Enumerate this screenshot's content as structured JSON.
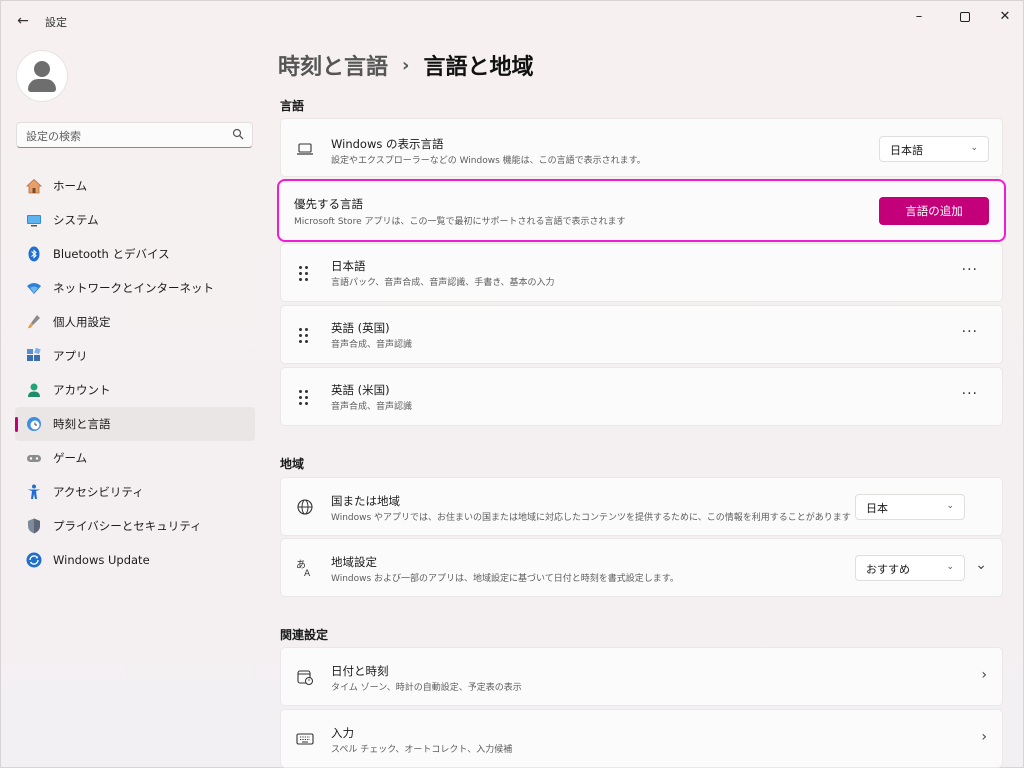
{
  "window": {
    "title": "設定"
  },
  "search": {
    "placeholder": "設定の検索"
  },
  "sidebar": {
    "items": [
      {
        "label": "ホーム",
        "icon": "home-icon"
      },
      {
        "label": "システム",
        "icon": "system-icon"
      },
      {
        "label": "Bluetooth とデバイス",
        "icon": "bluetooth-icon"
      },
      {
        "label": "ネットワークとインターネット",
        "icon": "network-icon"
      },
      {
        "label": "個人用設定",
        "icon": "personalization-icon"
      },
      {
        "label": "アプリ",
        "icon": "apps-icon"
      },
      {
        "label": "アカウント",
        "icon": "account-icon"
      },
      {
        "label": "時刻と言語",
        "icon": "time-language-icon",
        "active": true
      },
      {
        "label": "ゲーム",
        "icon": "game-icon"
      },
      {
        "label": "アクセシビリティ",
        "icon": "accessibility-icon"
      },
      {
        "label": "プライバシーとセキュリティ",
        "icon": "shield-icon"
      },
      {
        "label": "Windows Update",
        "icon": "update-icon"
      }
    ]
  },
  "breadcrumb": {
    "parent": "時刻と言語",
    "separator": "›",
    "current": "言語と地域"
  },
  "sections": {
    "language": "言語",
    "region": "地域",
    "related": "関連設定"
  },
  "display_language": {
    "title": "Windows の表示言語",
    "desc": "設定やエクスプローラーなどの Windows 機能は、この言語で表示されます。",
    "value": "日本語"
  },
  "preferred": {
    "title": "優先する言語",
    "desc": "Microsoft Store アプリは、この一覧で最初にサポートされる言語で表示されます",
    "button": "言語の追加"
  },
  "languages": [
    {
      "title": "日本語",
      "desc": "言語パック、音声合成、音声認識、手書き、基本の入力"
    },
    {
      "title": "英語 (英国)",
      "desc": "音声合成、音声認識"
    },
    {
      "title": "英語 (米国)",
      "desc": "音声合成、音声認識"
    }
  ],
  "country": {
    "title": "国または地域",
    "desc": "Windows やアプリでは、お住まいの国または地域に対応したコンテンツを提供するために、この情報を利用することがあります",
    "value": "日本"
  },
  "regional_format": {
    "title": "地域設定",
    "desc": "Windows および一部のアプリは、地域設定に基づいて日付と時刻を書式設定します。",
    "value": "おすすめ"
  },
  "related": [
    {
      "title": "日付と時刻",
      "desc": "タイム ゾーン、時計の自動設定、予定表の表示"
    },
    {
      "title": "入力",
      "desc": "スペル チェック、オートコレクト、入力候補"
    }
  ],
  "colors": {
    "accent": "#c30079",
    "highlight": "#f01bd5"
  }
}
